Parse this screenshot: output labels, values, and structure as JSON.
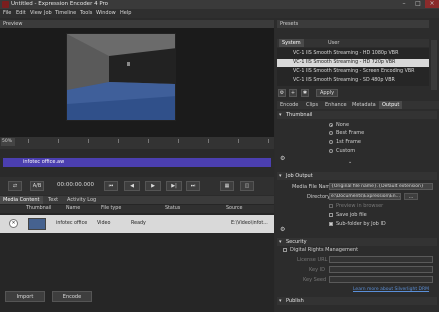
{
  "window": {
    "title": "Untitled - Expression Encoder 4 Pro",
    "minimize": "–",
    "maximize": "□",
    "close": "×"
  },
  "menu": [
    "File",
    "Edit",
    "View",
    "Job",
    "Timeline",
    "Tools",
    "Window",
    "Help"
  ],
  "preview": {
    "label": "Preview"
  },
  "timeline": {
    "zoom": "50%",
    "clip_name": "infotec office.aw"
  },
  "transport": {
    "mode": "A/B",
    "timecode": "00:00:00.000"
  },
  "media": {
    "tabs": [
      "Media Content",
      "Text",
      "Activity Log"
    ],
    "columns": [
      "Thumbnail",
      "Name",
      "File type",
      "Status",
      "Source"
    ],
    "rows": [
      {
        "name": "infotec office",
        "type": "Video",
        "status": "Ready",
        "source": "E:\\Video\\infot..."
      }
    ],
    "import_label": "Import",
    "encode_label": "Encode"
  },
  "presets": {
    "title": "Presets",
    "tabs": [
      "System",
      "User"
    ],
    "items": [
      "VC-1 IIS Smooth Streaming - HD 1080p VBR",
      "VC-1 IIS Smooth Streaming - HD 720p VBR",
      "VC-1 IIS Smooth Streaming - Screen Encoding VBR",
      "VC-1 IIS Smooth Streaming - SD 480p VBR"
    ],
    "selected_index": 1,
    "apply_label": "Apply"
  },
  "right_tabs": [
    "Encode",
    "Clips",
    "Enhance",
    "Metadata",
    "Output"
  ],
  "thumbnail": {
    "title": "Thumbnail",
    "options": [
      "None",
      "Best Frame",
      "1st Frame",
      "Custom"
    ],
    "selected": 0
  },
  "job_output": {
    "title": "Job Output",
    "file_name_label": "Media File Name",
    "file_name_value": "{Original file name}.{Default extension}",
    "directory_label": "Directory",
    "directory_value": "e:\\Documents\\Expression\\En...",
    "browse": "...",
    "checks": [
      {
        "label": "Preview in browser",
        "checked": false,
        "disabled": true
      },
      {
        "label": "Save job file",
        "checked": false,
        "disabled": false
      },
      {
        "label": "Sub-folder by Job ID",
        "checked": true,
        "disabled": false
      }
    ]
  },
  "security": {
    "title": "Security",
    "drm_label": "Digital Rights Management",
    "fields": [
      "License URL",
      "Key ID",
      "Key Seed"
    ],
    "link": "Learn more about Silverlight DRM"
  },
  "publish": {
    "title": "Publish"
  },
  "colors": {
    "accent": "#4b3fb0",
    "selection": "#d9d9d9",
    "link": "#5a8fd8"
  }
}
